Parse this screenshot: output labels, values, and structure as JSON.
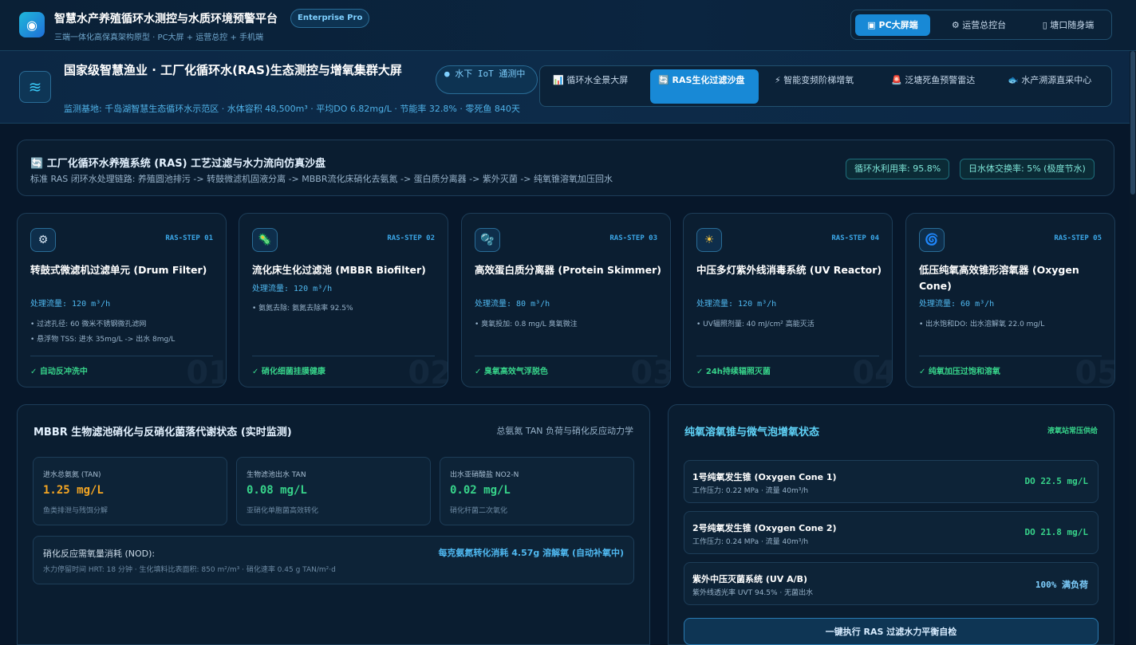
{
  "app": {
    "title": "智慧水产养殖循环水测控与水质环境预警平台",
    "badge": "Enterprise Pro",
    "subtitle": "三端一体化高保真架构原型 · PC大屏 + 运营总控 + 手机端",
    "views": [
      {
        "label": "PC大屏端",
        "icon": "▣",
        "active": true
      },
      {
        "label": "运营总控台",
        "icon": "⚙",
        "active": false
      },
      {
        "label": "塘口随身端",
        "icon": "▯",
        "active": false
      }
    ]
  },
  "hero": {
    "title": "国家级智慧渔业 · 工厂化循环水(RAS)生态测控与增氧集群大屏",
    "pill": "● 水下 IoT 通测中",
    "meta": "监测基地: 千岛湖智慧生态循环水示范区 · 水体容积 48,500m³ · 平均DO 6.82mg/L · 节能率 32.8% · 零死鱼 840天",
    "tabs": [
      {
        "label": "📊 循环水全景大屏",
        "active": false
      },
      {
        "label": "🔄 RAS生化过滤沙盘",
        "active": true
      },
      {
        "label": "⚡ 智能变频阶梯增氧",
        "active": false
      },
      {
        "label": "🚨 泛塘死鱼预警雷达",
        "active": false
      },
      {
        "label": "🐟 水产溯源直采中心",
        "active": false
      }
    ]
  },
  "process": {
    "title": "工厂化循环水养殖系统 (RAS) 工艺过滤与水力流向仿真沙盘",
    "desc": "标准 RAS 闭环水处理链路: 养殖圆池排污 -> 转鼓微滤机固液分离 -> MBBR流化床硝化去氨氮 -> 蛋白质分离器 -> 紫外灭菌 -> 纯氧锥溶氧加压回水",
    "chip1": "循环水利用率: 95.8%",
    "chip2": "日水体交换率: 5% (极度节水)"
  },
  "steps": [
    {
      "icon": "⚙",
      "code": "RAS-STEP 01",
      "name": "转鼓式微滤机过滤单元 (Drum Filter)",
      "flow": "处理流量: 120 m³/h",
      "notes": [
        "• 过滤孔径: 60 微米不锈钢微孔滤网",
        "• 悬浮物 TSS: 进水 35mg/L -> 出水 8mg/L"
      ],
      "status": "✓ 自动反冲洗中",
      "num": "01"
    },
    {
      "icon": "🦠",
      "code": "RAS-STEP 02",
      "name": "流化床生化过滤池 (MBBR Biofilter)",
      "flow": "处理流量: 120 m³/h",
      "notes": [
        "• 氨氮去除: 氨氮去除率 92.5%"
      ],
      "status": "✓ 硝化细菌挂膜健康",
      "num": "02"
    },
    {
      "icon": "🫧",
      "code": "RAS-STEP 03",
      "name": "高效蛋白质分离器 (Protein Skimmer)",
      "flow": "处理流量: 80 m³/h",
      "notes": [
        "• 臭氧投加: 0.8 mg/L 臭氧微注"
      ],
      "status": "✓ 臭氧高效气浮脱色",
      "num": "03"
    },
    {
      "icon": "☀",
      "code": "RAS-STEP 04",
      "name": "中压多灯紫外线消毒系统 (UV Reactor)",
      "flow": "处理流量: 120 m³/h",
      "notes": [
        "• UV辐照剂量: 40 mJ/cm² 高能灭活"
      ],
      "status": "✓ 24h持续辐照灭菌",
      "num": "04"
    },
    {
      "icon": "🌀",
      "code": "RAS-STEP 05",
      "name": "低压纯氧高效锥形溶氧器 (Oxygen Cone)",
      "flow": "处理流量: 60 m³/h",
      "notes": [
        "• 出水饱和DO: 出水溶解氧 22.0 mg/L"
      ],
      "status": "✓ 纯氧加压过饱和溶氧",
      "num": "05"
    }
  ],
  "mbbr": {
    "title": "MBBR 生物滤池硝化与反硝化菌落代谢状态 (实时监测)",
    "subtitle": "总氨氮 TAN 负荷与硝化反应动力学",
    "metrics": [
      {
        "label": "进水总氨氮 (TAN)",
        "value": "1.25 mg/L",
        "desc": "鱼类排泄与残饵分解",
        "color": "#f5a623"
      },
      {
        "label": "生物滤池出水 TAN",
        "value": "0.08 mg/L",
        "desc": "亚硝化单胞菌高效转化",
        "color": "#37d38a"
      },
      {
        "label": "出水亚硝酸盐 NO2-N",
        "value": "0.02 mg/L",
        "desc": "硝化杆菌二次氧化",
        "color": "#37d38a"
      }
    ],
    "nod_label": "硝化反应需氧量消耗 (NOD):",
    "nod_desc": "水力停留时间 HRT: 18 分钟 · 生化填料比表面积: 850 m²/m³ · 硝化速率 0.45 g TAN/m²·d",
    "nod_value": "每克氨氮转化消耗 4.57g 溶解氧 (自动补氧中)"
  },
  "oxygen": {
    "title": "纯氧溶氧锥与微气泡增氧状态",
    "tag": "液氧站常压供给",
    "items": [
      {
        "name": "1号纯氧发生锥 (Oxygen Cone 1)",
        "desc": "工作压力: 0.22 MPa · 流量 40m³/h",
        "value": "DO 22.5 mg/L",
        "color": "#37d38a"
      },
      {
        "name": "2号纯氧发生锥 (Oxygen Cone 2)",
        "desc": "工作压力: 0.24 MPa · 流量 40m³/h",
        "value": "DO 21.8 mg/L",
        "color": "#37d38a"
      },
      {
        "name": "紫外中压灭菌系统 (UV A/B)",
        "desc": "紫外线透光率 UVT 94.5% · 无菌出水",
        "value": "100% 满负荷",
        "color": "#7fd0ff"
      }
    ],
    "action": "一键执行 RAS 过滤水力平衡自检"
  }
}
